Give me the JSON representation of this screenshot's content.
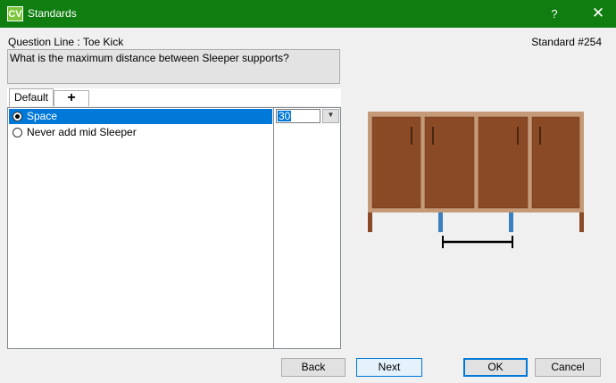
{
  "window": {
    "app_icon_text": "CV",
    "title": "Standards",
    "help_label": "?",
    "close_label": "✕"
  },
  "header": {
    "question_line": "Question Line : Toe Kick",
    "standard_number": "Standard #254"
  },
  "question": {
    "text": "What is the maximum distance between Sleeper supports?"
  },
  "tabs": [
    {
      "label": "Default",
      "selected": true
    },
    {
      "label": "+",
      "selected": false
    }
  ],
  "options": [
    {
      "label": "Space",
      "selected": true,
      "value": "30"
    },
    {
      "label": "Never add mid Sleeper",
      "selected": false
    }
  ],
  "buttons": {
    "back": "Back",
    "next": "Next",
    "ok": "OK",
    "cancel": "Cancel"
  },
  "colors": {
    "titlebar": "#0f7d0f",
    "app_icon": "#7cc63c",
    "selection": "#0078d7",
    "cabinet_frame": "#c59a78",
    "cabinet_door": "#8b4a26",
    "sleeper_support": "#3a7fc0"
  },
  "icons": {
    "app": "cv-app-icon",
    "help": "question-mark-icon",
    "close": "close-icon",
    "add_tab": "plus-icon",
    "dropdown": "chevron-down-icon"
  }
}
